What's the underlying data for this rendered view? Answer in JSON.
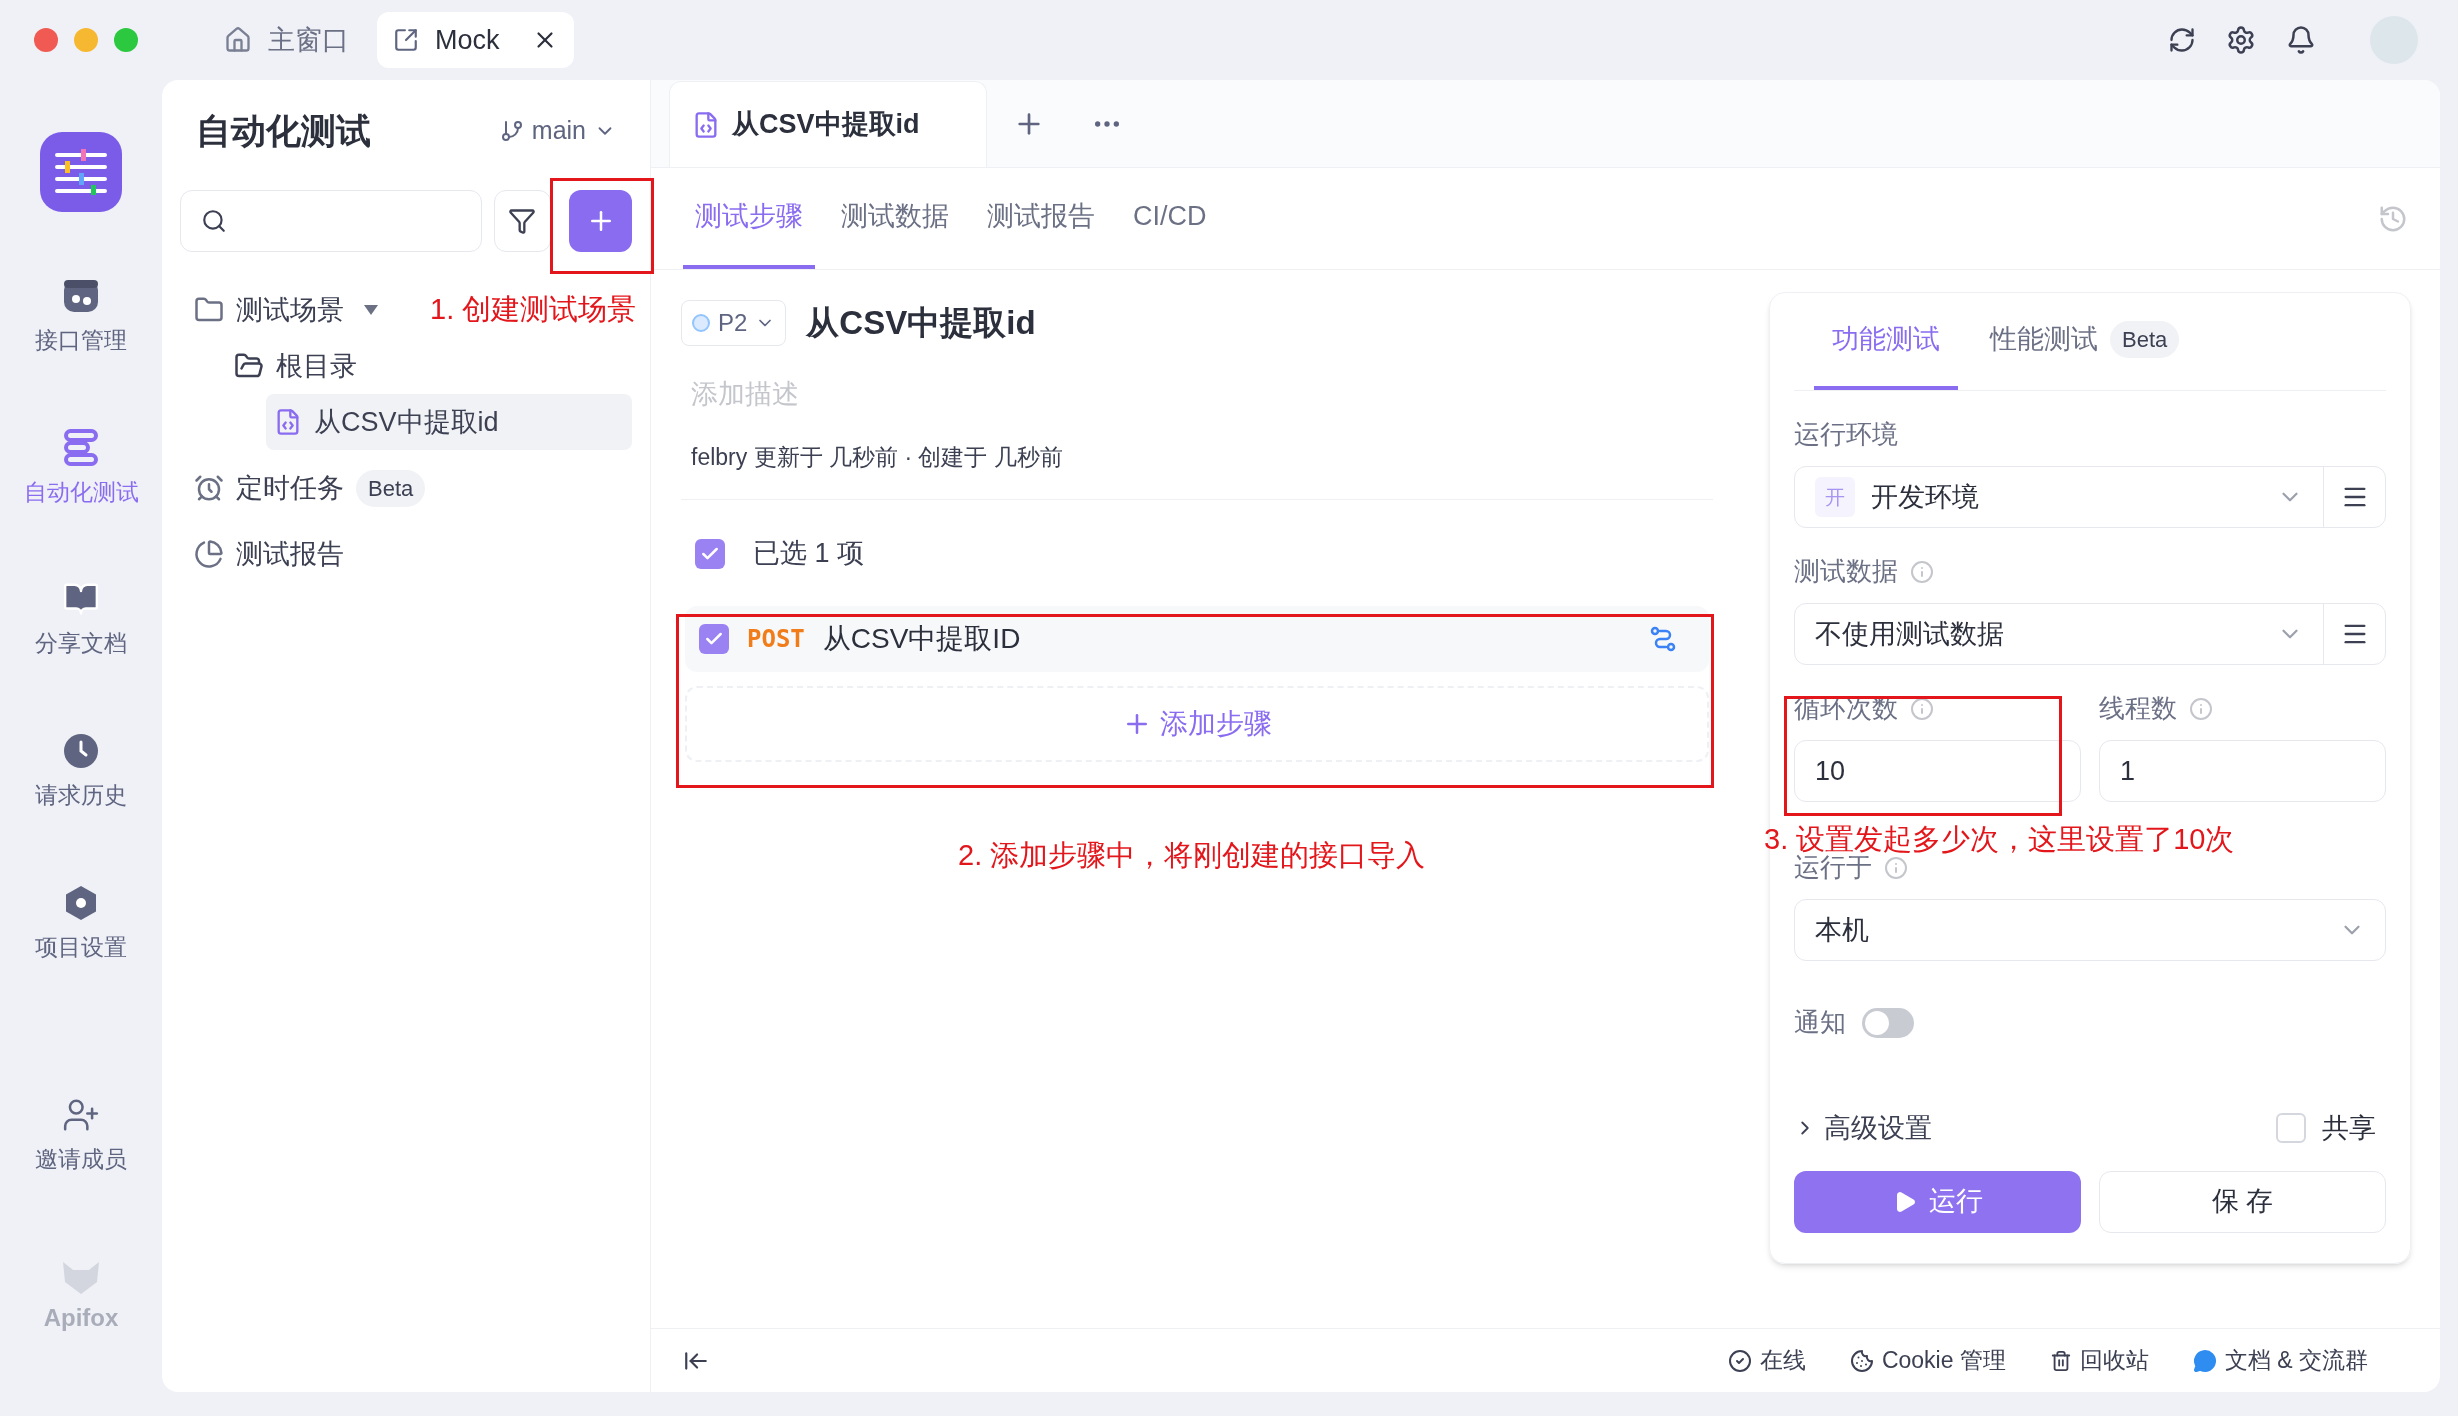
{
  "window": {
    "tabs": [
      {
        "label": "主窗口",
        "kind": "home",
        "selected": false
      },
      {
        "label": "Mock",
        "kind": "mock",
        "selected": true
      }
    ]
  },
  "rail": {
    "items": [
      {
        "label": "接口管理",
        "kind": "api",
        "selected": false
      },
      {
        "label": "自动化测试",
        "kind": "automation",
        "selected": true
      },
      {
        "label": "分享文档",
        "kind": "docs",
        "selected": false
      },
      {
        "label": "请求历史",
        "kind": "history",
        "selected": false
      },
      {
        "label": "项目设置",
        "kind": "settings",
        "selected": false
      },
      {
        "label": "邀请成员",
        "kind": "invite",
        "selected": false
      }
    ],
    "logo_text": "Apifox"
  },
  "project": {
    "title": "自动化测试",
    "branch": "main"
  },
  "tree": [
    {
      "label": "测试场景",
      "kind": "scenario",
      "expanded": true,
      "children": [
        {
          "label": "根目录",
          "kind": "folder",
          "children": [
            {
              "label": "从CSV中提取id",
              "kind": "case",
              "selected": true
            }
          ]
        }
      ]
    },
    {
      "label": "定时任务",
      "kind": "schedule",
      "badge": "Beta"
    },
    {
      "label": "测试报告",
      "kind": "report"
    }
  ],
  "editor_tabs": [
    {
      "label": "从CSV中提取id",
      "selected": true
    }
  ],
  "sub_tabs": [
    {
      "label": "测试步骤",
      "selected": true
    },
    {
      "label": "测试数据",
      "selected": false
    },
    {
      "label": "测试报告",
      "selected": false
    },
    {
      "label": "CI/CD",
      "selected": false
    }
  ],
  "scenario": {
    "priority": "P2",
    "name": "从CSV中提取id",
    "description_placeholder": "添加描述",
    "meta": "felbry 更新于 几秒前 · 创建于 几秒前",
    "selection": {
      "checked": true,
      "label": "已选 1 项"
    },
    "steps": [
      {
        "checked": true,
        "method": "POST",
        "name": "从CSV中提取ID"
      }
    ],
    "add_step": "添加步骤"
  },
  "run_panel": {
    "tabs": [
      {
        "label": "功能测试",
        "selected": true
      },
      {
        "label": "性能测试",
        "selected": false,
        "badge": "Beta"
      }
    ],
    "environment": {
      "label": "运行环境",
      "badge": "开",
      "value": "开发环境"
    },
    "test_data": {
      "label": "测试数据",
      "value": "不使用测试数据"
    },
    "loops": {
      "label": "循环次数",
      "value": "10"
    },
    "threads": {
      "label": "线程数",
      "value": "1"
    },
    "run_on": {
      "label": "运行于",
      "value": "本机"
    },
    "notify": {
      "label": "通知",
      "on": false
    },
    "advanced": {
      "label": "高级设置",
      "expanded": false
    },
    "share": {
      "label": "共享",
      "checked": false
    },
    "run_button": "运行",
    "save_button": "保 存"
  },
  "status_bar": {
    "items": [
      {
        "kind": "online",
        "label": "在线"
      },
      {
        "kind": "cookie",
        "label": "Cookie 管理"
      },
      {
        "kind": "trash",
        "label": "回收站"
      },
      {
        "kind": "chat",
        "label": "文档 & 交流群"
      }
    ]
  },
  "annotations": [
    {
      "text": "1. 创建测试场景"
    },
    {
      "text": "2. 添加步骤中，将刚创建的接口导入"
    },
    {
      "text": "3. 设置发起多少次，这里设置了10次"
    }
  ]
}
